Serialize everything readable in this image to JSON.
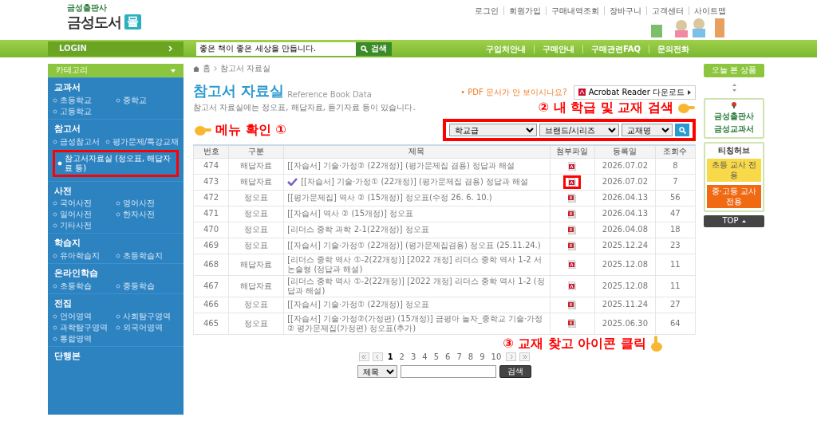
{
  "header": {
    "publisher": "금성출판사",
    "logo": "금성도서",
    "logo_badge": "몰",
    "top_links": [
      "로그인",
      "회원가입",
      "구매내역조회",
      "장바구니",
      "고객센터",
      "사이트맵"
    ]
  },
  "navbar": {
    "login": "LOGIN",
    "search_value": "좋은 책이 좋은 세상을 만듭니다.",
    "search_button": "검색",
    "links": [
      "구입처안내",
      "구매안내",
      "구매관련FAQ",
      "문의전화"
    ]
  },
  "sidebar": {
    "title": "카테고리",
    "sections": [
      {
        "heading": "교과서",
        "items": [
          {
            "label": "초등학교",
            "selected": false
          },
          {
            "label": "중학교",
            "selected": false
          },
          {
            "label": "고등학교",
            "selected": false
          }
        ]
      },
      {
        "heading": "참고서",
        "items": [
          {
            "label": "금성참고서",
            "selected": false
          },
          {
            "label": "평가문제/특강교재",
            "selected": false
          },
          {
            "label": "참고서자료실 (정오표, 해답자료 등)",
            "selected": true
          }
        ]
      },
      {
        "heading": "사전",
        "items": [
          {
            "label": "국어사전",
            "selected": false
          },
          {
            "label": "영어사전",
            "selected": false
          },
          {
            "label": "일어사전",
            "selected": false
          },
          {
            "label": "한자사전",
            "selected": false
          },
          {
            "label": "기타사전",
            "selected": false
          }
        ]
      },
      {
        "heading": "학습지",
        "items": [
          {
            "label": "유아학습지",
            "selected": false
          },
          {
            "label": "초등학습지",
            "selected": false
          }
        ]
      },
      {
        "heading": "온라인학습",
        "items": [
          {
            "label": "초등학습",
            "selected": false
          },
          {
            "label": "중등학습",
            "selected": false
          }
        ]
      },
      {
        "heading": "전집",
        "items": [
          {
            "label": "언어영역",
            "selected": false
          },
          {
            "label": "사회탐구영역",
            "selected": false
          },
          {
            "label": "과학탐구영역",
            "selected": false
          },
          {
            "label": "외국어영역",
            "selected": false
          },
          {
            "label": "통합영역",
            "selected": false
          }
        ]
      },
      {
        "heading": "단행본"
      }
    ]
  },
  "breadcrumb": [
    "홈",
    "참고서 자료실"
  ],
  "page": {
    "title": "참고서 자료실",
    "title_en": "Reference Book Data",
    "description": "참고서 자료실에는 정오표, 해답자료, 듣기자료 등이 있습니다.",
    "pdf_notice": "• PDF 문서가 안 보이시나요?",
    "acrobat_button": "Acrobat Reader 다운로드"
  },
  "filters": [
    {
      "value": "학교급"
    },
    {
      "value": "브랜드/시리즈"
    },
    {
      "value": "교재명"
    }
  ],
  "table": {
    "columns": [
      "번호",
      "구분",
      "제목",
      "첨부파일",
      "등록일",
      "조회수"
    ],
    "rows": [
      {
        "number": "474",
        "category": "해답자료",
        "title": "[[자습서] 기술·가정② (22개정)] (평가문제집 겸용) 정답과 해설",
        "kind": "pdf",
        "date": "2026.07.02",
        "views": "8",
        "highlighted": false
      },
      {
        "number": "473",
        "category": "해답자료",
        "title": "[[자습서] 기술·가정① (22개정)] (평가문제집 겸용) 정답과 해설",
        "kind": "pdf",
        "date": "2026.07.02",
        "views": "7",
        "highlighted": true
      },
      {
        "number": "472",
        "category": "정오표",
        "title": "[[평가문제집] 역사 ② (15개정)] 정오표(수정 26. 6. 10.)",
        "kind": "doc",
        "date": "2026.04.13",
        "views": "56",
        "highlighted": false
      },
      {
        "number": "471",
        "category": "정오표",
        "title": "[[자습서] 역사 ② (15개정)] 정오표",
        "kind": "doc",
        "date": "2026.04.13",
        "views": "47",
        "highlighted": false
      },
      {
        "number": "470",
        "category": "정오표",
        "title": "[리더스 중학 과학 2-1(22개정)] 정오표",
        "kind": "doc",
        "date": "2026.04.08",
        "views": "18",
        "highlighted": false
      },
      {
        "number": "469",
        "category": "정오표",
        "title": "[[자습서] 기술·가정① (22개정)] (평가문제집겸용) 정오표 (25.11.24.)",
        "kind": "doc",
        "date": "2025.12.24",
        "views": "23",
        "highlighted": false
      },
      {
        "number": "468",
        "category": "해답자료",
        "title": "[리더스 중학 역사 ①-2(22개정)] [2022 개정] 리더스 중학 역사 1-2 서논술형 (정답과 해설)",
        "kind": "pdf",
        "date": "2025.12.08",
        "views": "11",
        "highlighted": false
      },
      {
        "number": "467",
        "category": "해답자료",
        "title": "[리더스 중학 역사 ①-2(22개정)] [2022 개정] 리더스 중학 역사 1-2 (정답과 해설)",
        "kind": "pdf",
        "date": "2025.12.08",
        "views": "11",
        "highlighted": false
      },
      {
        "number": "466",
        "category": "정오표",
        "title": "[[자습서] 기술·가정① (22개정)] 정오표",
        "kind": "doc",
        "date": "2025.11.24",
        "views": "27",
        "highlighted": false
      },
      {
        "number": "465",
        "category": "정오표",
        "title": "[[자습서] 기술·가정②(가정편) (15개정)] 금평아 놀자_중학교 기술·가정② 평가문제집(가정편) 정오표(추가)",
        "kind": "doc",
        "date": "2025.06.30",
        "views": "64",
        "highlighted": false
      }
    ]
  },
  "pagination": {
    "pages": [
      {
        "label": "1",
        "selected": true
      },
      {
        "label": "2",
        "selected": false
      },
      {
        "label": "3",
        "selected": false
      },
      {
        "label": "4",
        "selected": false
      },
      {
        "label": "5",
        "selected": false
      },
      {
        "label": "6",
        "selected": false
      },
      {
        "label": "7",
        "selected": false
      },
      {
        "label": "8",
        "selected": false
      },
      {
        "label": "9",
        "selected": false
      },
      {
        "label": "10",
        "selected": false
      }
    ]
  },
  "board_search": {
    "field": "제목",
    "button": "검색"
  },
  "right_rail": {
    "recent": "오늘 본 상품",
    "brand_1": "금성출판사",
    "brand_2": "금성교과서",
    "hub": "티칭허브",
    "elementary": "초등 교사 전용",
    "secondary": "중·고등 교사 전용",
    "top": "TOP"
  },
  "annotations": [
    "메뉴 확인 ①",
    "② 내 학급 및 교재 검색",
    "③ 교재 찾고 아이콘 클릭"
  ]
}
